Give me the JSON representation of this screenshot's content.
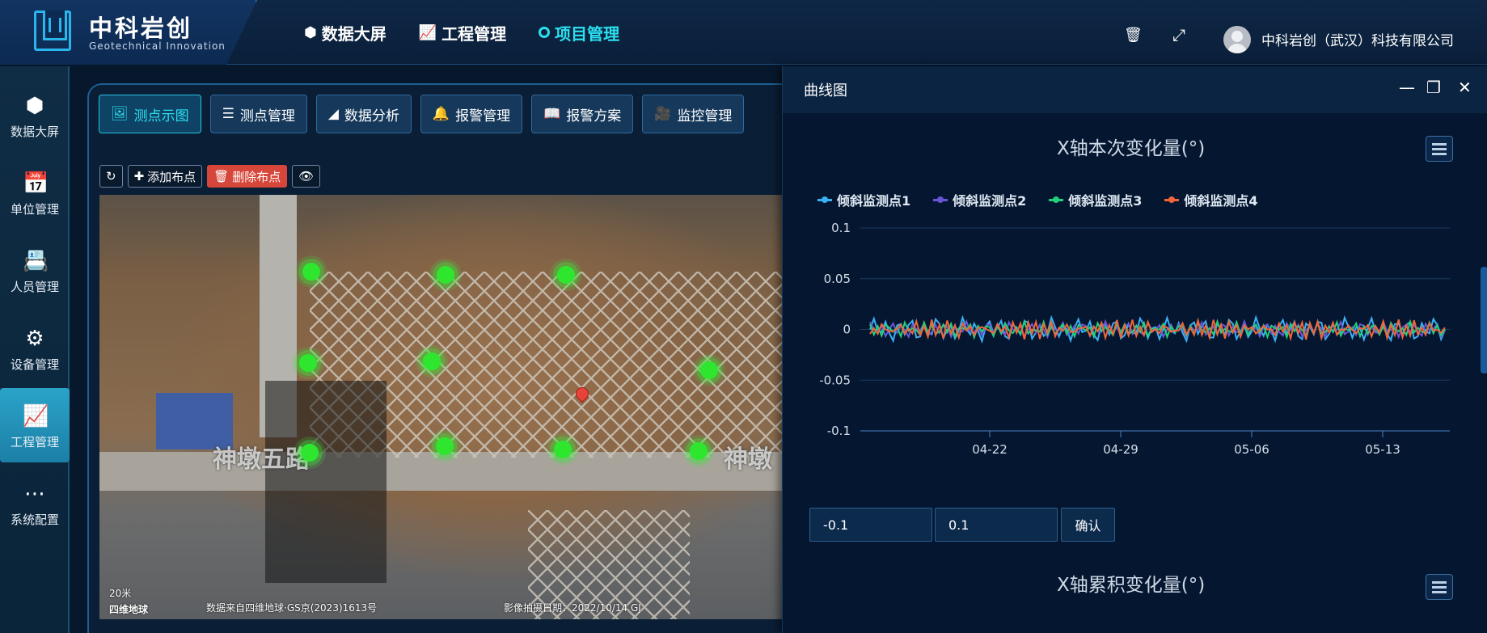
{
  "header": {
    "brand_title": "中科岩创",
    "brand_sub": "Geotechnical Innovation",
    "nav": [
      {
        "label": "数据大屏",
        "icon": "cube-icon"
      },
      {
        "label": "工程管理",
        "icon": "chart-monitor-icon"
      },
      {
        "label": "项目管理",
        "icon": "ring-icon",
        "active": true
      }
    ],
    "company": "中科岩创（武汉）科技有限公司"
  },
  "sidebar": {
    "items": [
      {
        "label": "数据大屏",
        "icon": "cube-icon"
      },
      {
        "label": "单位管理",
        "icon": "calendar-check-icon"
      },
      {
        "label": "人员管理",
        "icon": "id-card-icon"
      },
      {
        "label": "设备管理",
        "icon": "gear-icon"
      },
      {
        "label": "工程管理",
        "icon": "chart-monitor-icon",
        "active": true
      },
      {
        "label": "系统配置",
        "icon": "dots-icon"
      }
    ]
  },
  "tabs": [
    {
      "label": "测点示图",
      "icon": "image-icon",
      "active": true
    },
    {
      "label": "测点管理",
      "icon": "list-icon"
    },
    {
      "label": "数据分析",
      "icon": "area-chart-icon"
    },
    {
      "label": "报警管理",
      "icon": "bell-icon"
    },
    {
      "label": "报警方案",
      "icon": "book-icon"
    },
    {
      "label": "监控管理",
      "icon": "video-icon"
    }
  ],
  "toolbar": {
    "add": "添加布点",
    "delete": "删除布点"
  },
  "map": {
    "labels": [
      "神墩五路",
      "神墩"
    ],
    "scale": "20米",
    "brand": "四维地球",
    "source": "数据来自四维地球·GS京(2023)1613号",
    "capture": "影像拍摄日期：2022/10/14 GJ"
  },
  "dialog": {
    "title": "曲线图",
    "chart1_title": "X轴本次变化量(°)",
    "chart2_title": "X轴累积变化量(°)",
    "range_min": "-0.1",
    "range_max": "0.1",
    "confirm": "确认"
  },
  "chart_data": {
    "type": "line",
    "title": "X轴本次变化量(°)",
    "xlabel": "",
    "ylabel": "",
    "ylim": [
      -0.1,
      0.1
    ],
    "y_ticks": [
      0.1,
      0.05,
      0,
      -0.05,
      -0.1
    ],
    "x_ticks": [
      "04-22",
      "04-29",
      "05-06",
      "05-13"
    ],
    "legend_position": "top-left",
    "series": [
      {
        "name": "倾斜监测点1",
        "color": "#3ab0f5",
        "amplitude": 0.012
      },
      {
        "name": "倾斜监测点2",
        "color": "#6a55d6",
        "amplitude": 0.008
      },
      {
        "name": "倾斜监测点3",
        "color": "#22d07a",
        "amplitude": 0.008
      },
      {
        "name": "倾斜监测点4",
        "color": "#f2643a",
        "amplitude": 0.01
      }
    ]
  }
}
